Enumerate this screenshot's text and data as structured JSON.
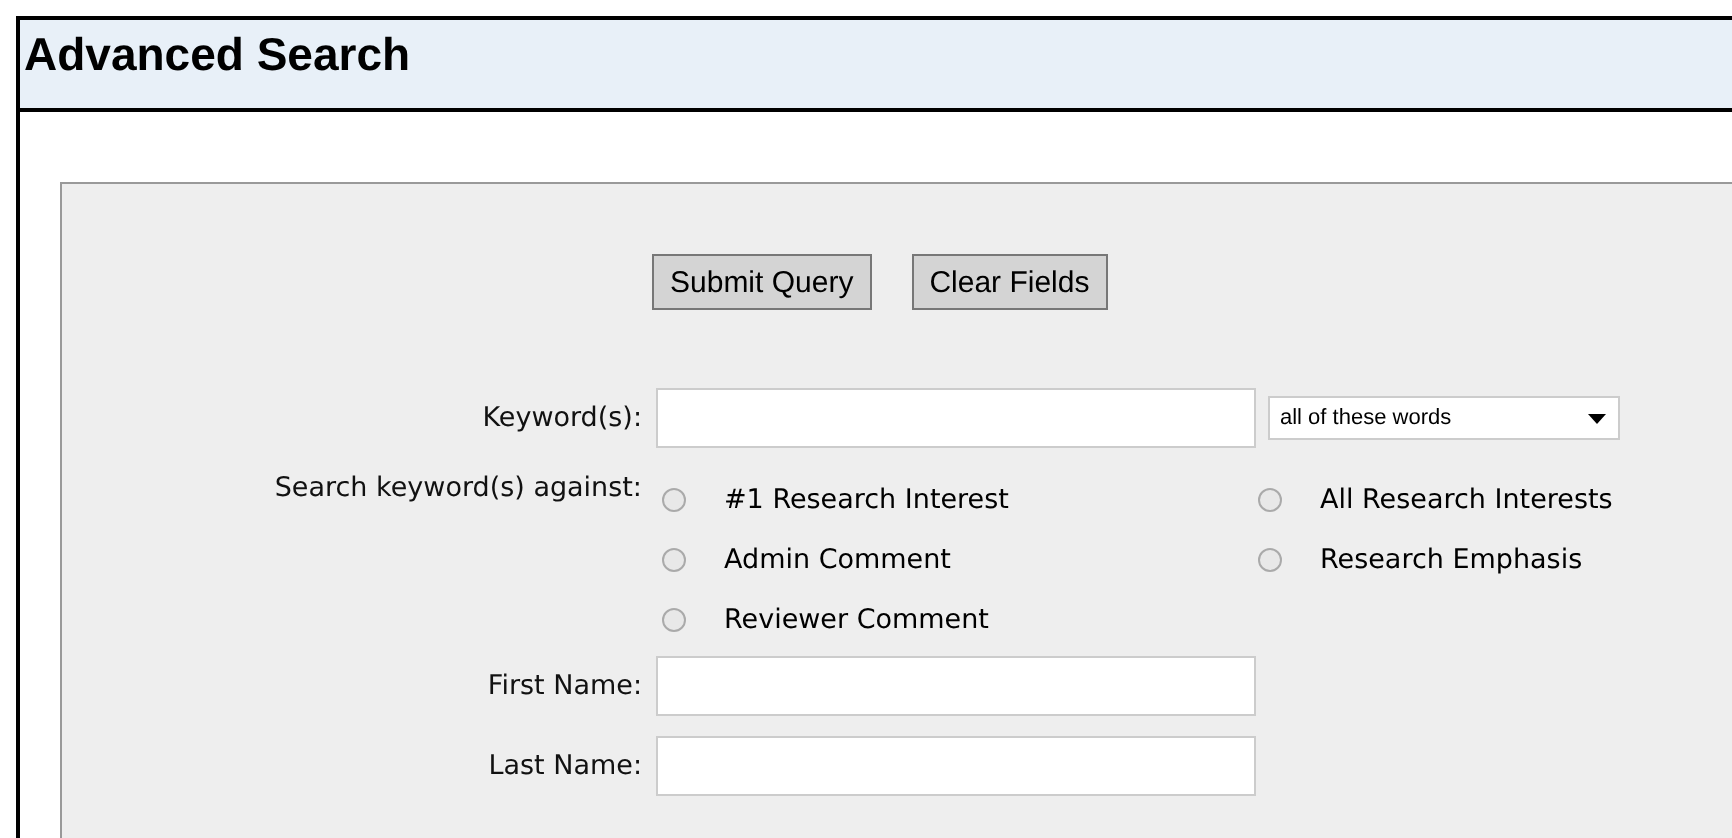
{
  "header": {
    "title": "Advanced Search"
  },
  "buttons": [
    "Submit Query",
    "Clear Fields"
  ],
  "keywords": {
    "label": "Keyword(s):",
    "mode": "all of these words"
  },
  "search_against": {
    "label": "Search keyword(s) against:",
    "options": [
      {
        "label": "#1 Research Interest",
        "selected": false
      },
      {
        "label": "All Research Interests",
        "selected": false
      },
      {
        "label": "Admin Comment",
        "selected": false
      },
      {
        "label": "Research Emphasis",
        "selected": false
      },
      {
        "label": "Reviewer Comment",
        "selected": false
      }
    ]
  },
  "fields": [
    {
      "label": "First Name:"
    },
    {
      "label": "Last Name:"
    }
  ]
}
